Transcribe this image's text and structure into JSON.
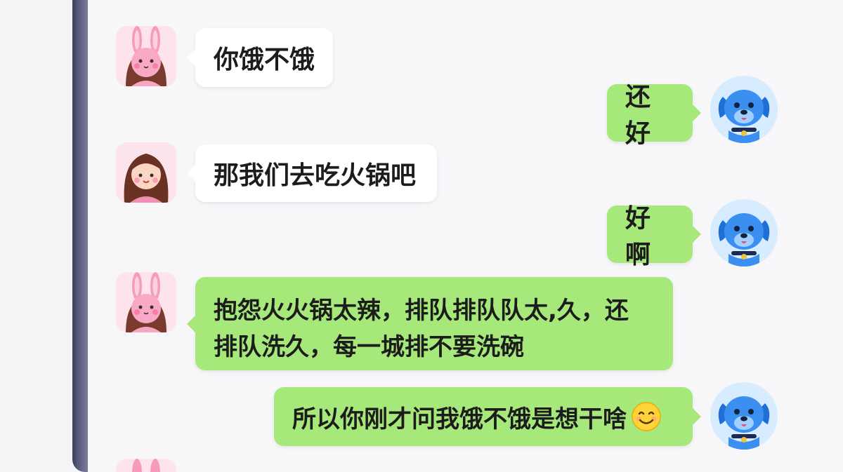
{
  "messages": [
    {
      "sender": "bunny",
      "side": "left",
      "text": "你饿不饿"
    },
    {
      "sender": "dog",
      "side": "right",
      "text": "还好"
    },
    {
      "sender": "girl",
      "side": "left",
      "text": "那我们去吃火锅吧"
    },
    {
      "sender": "dog",
      "side": "right",
      "text": "好啊"
    },
    {
      "sender": "bunny",
      "side": "left",
      "line1": "抱怨火火锅太辣，排队排队队太,久，还",
      "line2": "排队洗久，每一城排不要洗碗"
    },
    {
      "sender": "dog",
      "side": "right",
      "text": "所以你刚才问我饿不饿是想干啥",
      "emoji": "smiling-face-emoji"
    }
  ],
  "colors": {
    "white_bubble": "#ffffff",
    "green_bubble": "#a6e87a",
    "background": "#f7f7fa"
  }
}
